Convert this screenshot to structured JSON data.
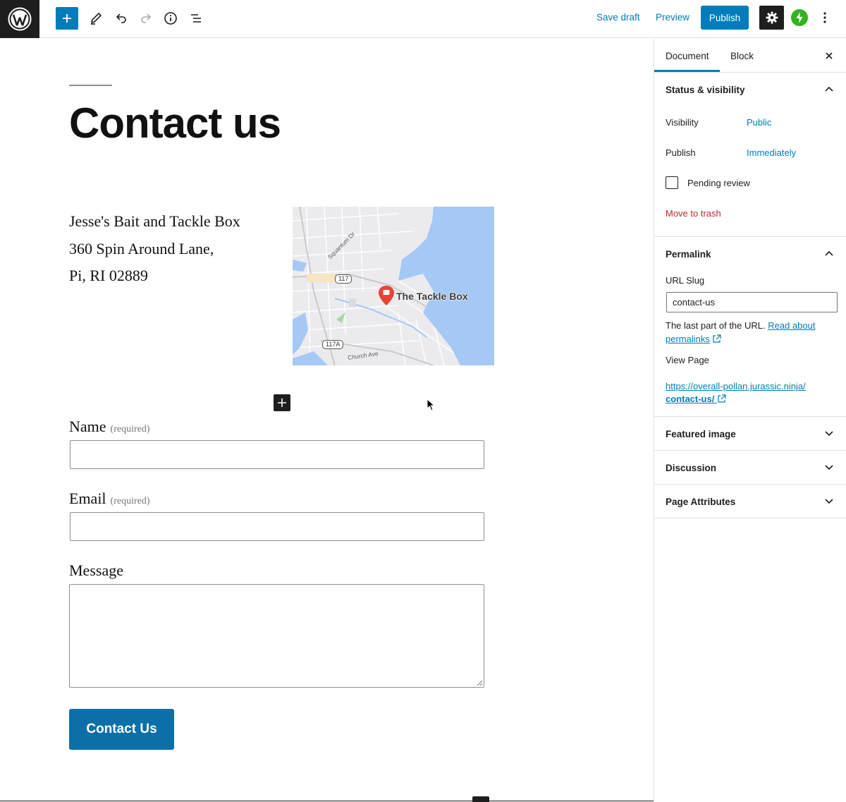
{
  "toolbar": {
    "save_draft": "Save draft",
    "preview": "Preview",
    "publish": "Publish"
  },
  "post": {
    "title": "Contact us",
    "address": [
      "Jesse's Bait and Tackle Box",
      "360 Spin Around Lane,",
      "Pi, RI 02889"
    ]
  },
  "map": {
    "place_label": "The Tackle Box",
    "route_117": "117",
    "route_117a": "117A",
    "street_squantum": "Squantum Dr",
    "street_church": "Church Ave"
  },
  "form": {
    "name_label": "Name",
    "email_label": "Email",
    "required_note": "(required)",
    "message_label": "Message",
    "submit_label": "Contact Us"
  },
  "sidebar": {
    "tab_document": "Document",
    "tab_block": "Block",
    "status": {
      "title": "Status & visibility",
      "visibility_label": "Visibility",
      "visibility_value": "Public",
      "publish_label": "Publish",
      "publish_value": "Immediately",
      "pending_review": "Pending review",
      "move_to_trash": "Move to trash"
    },
    "permalink": {
      "title": "Permalink",
      "url_slug_label": "URL Slug",
      "url_slug_value": "contact-us",
      "help_prefix": "The last part of the URL.",
      "help_link": "Read about permalinks",
      "view_page_label": "View Page",
      "url_prefix": "https://overall-pollan.jurassic.ninja/",
      "url_slug_bold": "contact-us/"
    },
    "featured_image": "Featured image",
    "discussion": "Discussion",
    "page_attributes": "Page Attributes"
  },
  "colors": {
    "accent": "#007cba",
    "dark": "#1e1e1e",
    "trash": "#b32d2e",
    "jetpack": "#2fb41f",
    "map_water": "#a6c8f5"
  }
}
